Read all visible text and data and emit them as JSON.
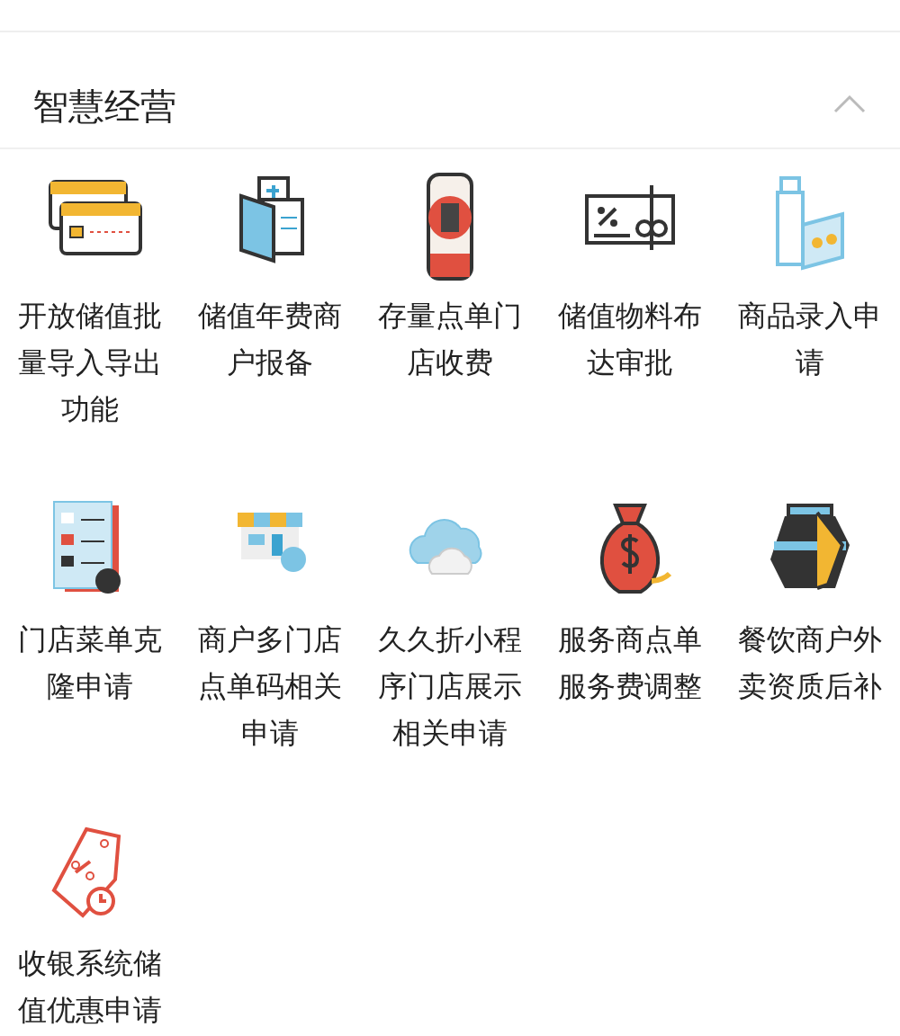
{
  "section": {
    "title": "智慧经营",
    "expanded": true
  },
  "items": [
    {
      "label": "开放储值批量导入导出功能"
    },
    {
      "label": "储值年费商户报备"
    },
    {
      "label": "存量点单门店收费"
    },
    {
      "label": "储值物料布达审批"
    },
    {
      "label": "商品录入申请"
    },
    {
      "label": "门店菜单克隆申请"
    },
    {
      "label": "商户多门店点单码相关申请"
    },
    {
      "label": "久久折小程序门店展示相关申请"
    },
    {
      "label": "服务商点单服务费调整"
    },
    {
      "label": "餐饮商户外卖资质后补"
    },
    {
      "label": "收银系统储值优惠申请"
    }
  ]
}
